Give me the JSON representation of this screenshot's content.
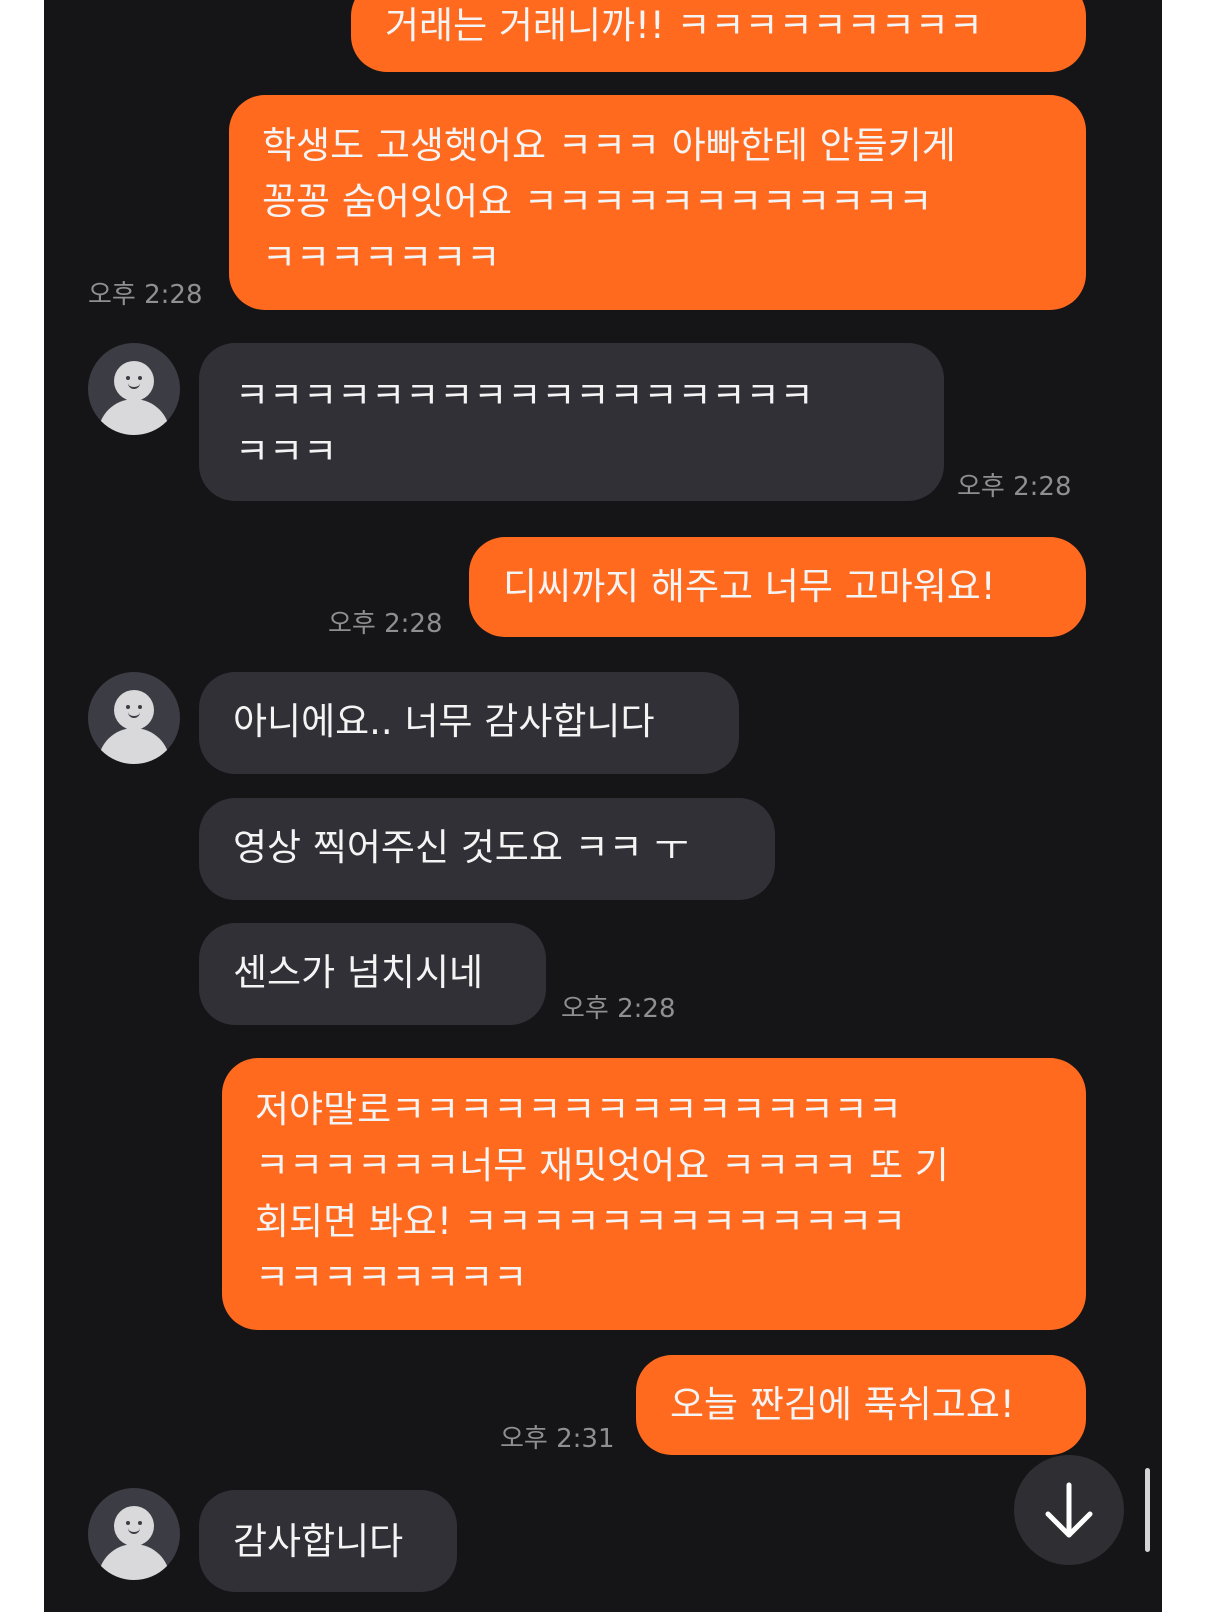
{
  "chat": {
    "messages": [
      {
        "from": "me",
        "text": "거래는 거래니까!! ㅋㅋㅋㅋㅋㅋㅋㅋㅋ"
      },
      {
        "from": "me",
        "text": "학생도 고생햇어요 ㅋㅋㅋ 아빠한테 안들키게\n꽁꽁 숨어잇어요 ㅋㅋㅋㅋㅋㅋㅋㅋㅋㅋㅋㅋ\nㅋㅋㅋㅋㅋㅋㅋ",
        "time": "오후 2:28"
      },
      {
        "from": "them",
        "text": "ㅋㅋㅋㅋㅋㅋㅋㅋㅋㅋㅋㅋㅋㅋㅋㅋㅋ\nㅋㅋㅋ",
        "time": "오후 2:28"
      },
      {
        "from": "me",
        "text": "디씨까지 해주고 너무 고마워요!",
        "time": "오후 2:28"
      },
      {
        "from": "them",
        "text": "아니에요.. 너무 감사합니다"
      },
      {
        "from": "them",
        "text": "영상 찍어주신 것도요 ㅋㅋ ㅜ"
      },
      {
        "from": "them",
        "text": "센스가 넘치시네",
        "time": "오후 2:28"
      },
      {
        "from": "me",
        "text": "저야말로ㅋㅋㅋㅋㅋㅋㅋㅋㅋㅋㅋㅋㅋㅋㅋ\nㅋㅋㅋㅋㅋㅋ너무 재밋엇어요 ㅋㅋㅋㅋ 또 기\n회되면 봐요! ㅋㅋㅋㅋㅋㅋㅋㅋㅋㅋㅋㅋㅋ\nㅋㅋㅋㅋㅋㅋㅋㅋ"
      },
      {
        "from": "me",
        "text": "오늘 짠김에 푹쉬고요!",
        "time": "오후 2:31"
      },
      {
        "from": "them",
        "text": "감사합니다"
      }
    ]
  },
  "icons": {
    "avatar": "default-profile-avatar-icon",
    "scroll_down": "arrow-down-icon"
  },
  "colors": {
    "background": "#151517",
    "my_bubble": "#ff6a1f",
    "their_bubble": "#303036",
    "timestamp": "#8e8e93"
  }
}
